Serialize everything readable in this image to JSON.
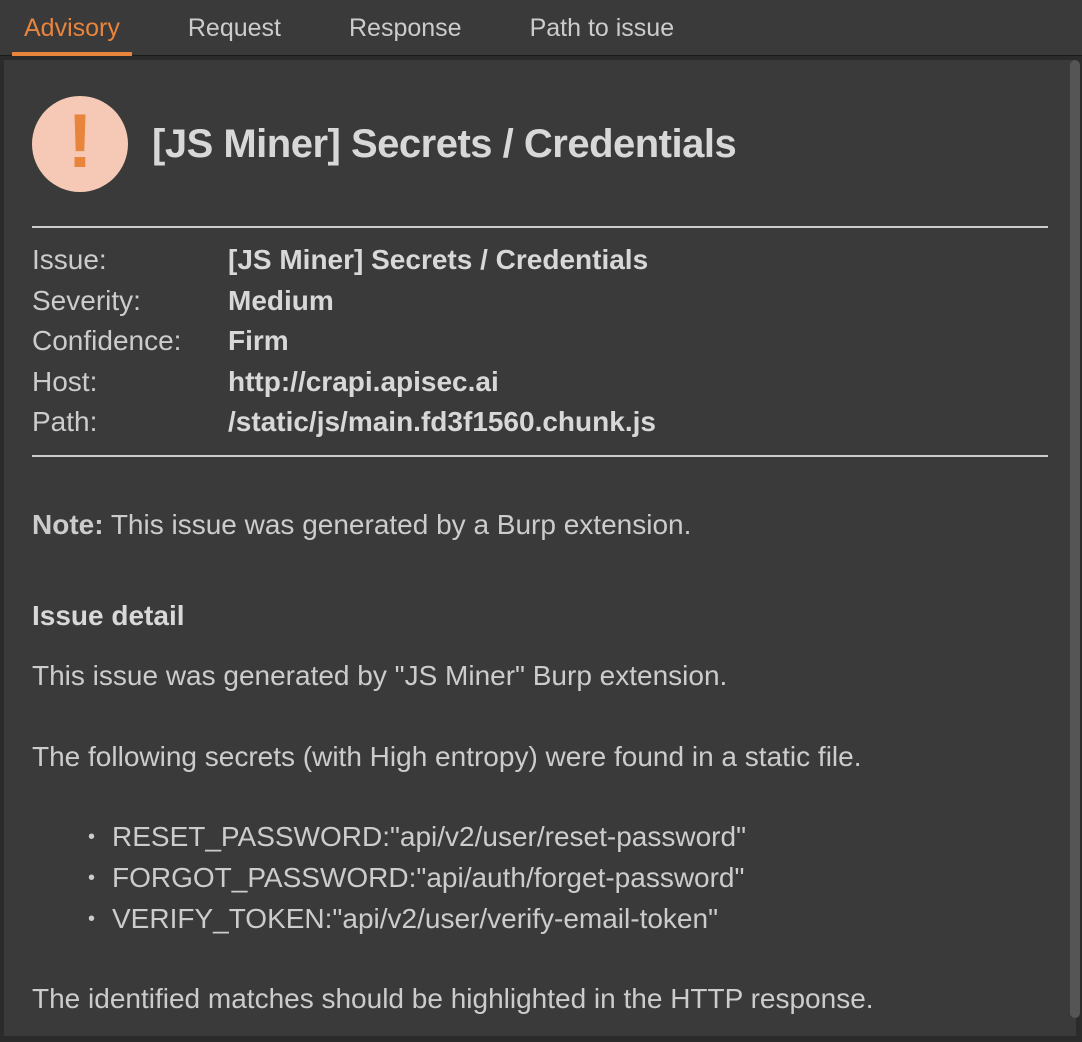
{
  "tabs": {
    "advisory": "Advisory",
    "request": "Request",
    "response": "Response",
    "path_to_issue": "Path to issue"
  },
  "title": "[JS Miner] Secrets / Credentials",
  "meta": {
    "issue_label": "Issue:",
    "issue_value": "[JS Miner] Secrets / Credentials",
    "severity_label": "Severity:",
    "severity_value": "Medium",
    "confidence_label": "Confidence:",
    "confidence_value": "Firm",
    "host_label": "Host:",
    "host_value": "http://crapi.apisec.ai",
    "path_label": "Path:",
    "path_value": "/static/js/main.fd3f1560.chunk.js"
  },
  "note": {
    "label": "Note:",
    "text": " This issue was generated by a Burp extension."
  },
  "detail": {
    "heading": "Issue detail",
    "line1": "This issue was generated by \"JS Miner\" Burp extension.",
    "line2": "The following secrets (with High entropy) were found in a static file.",
    "secrets": [
      "RESET_PASSWORD:\"api/v2/user/reset-password\"",
      "FORGOT_PASSWORD:\"api/auth/forget-password\"",
      "VERIFY_TOKEN:\"api/v2/user/verify-email-token\""
    ],
    "line3": "The identified matches should be highlighted in the HTTP response."
  }
}
